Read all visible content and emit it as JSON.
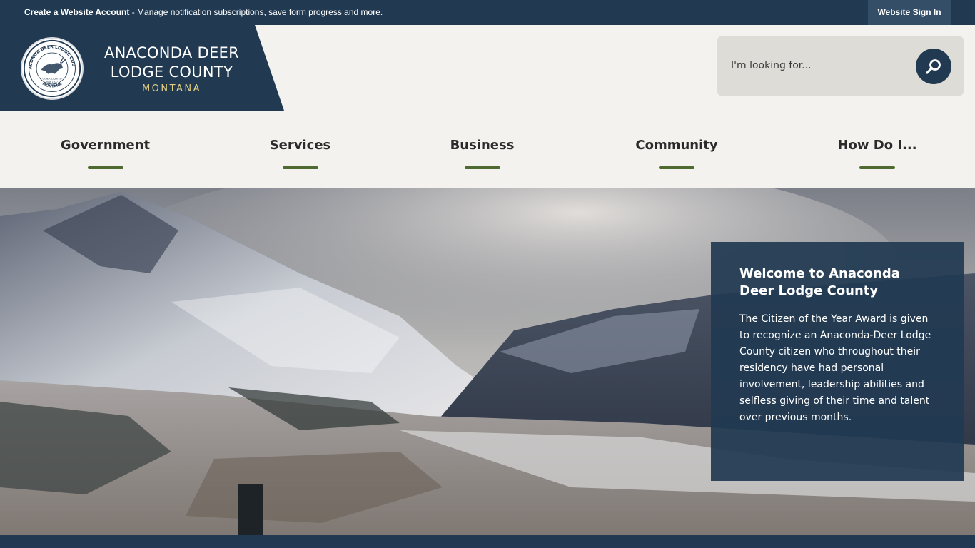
{
  "topbar": {
    "account_link": "Create a Website Account",
    "account_desc": " - Manage notification subscriptions, save form progress and more.",
    "signin_label": "Website Sign In"
  },
  "header": {
    "county_line1": "ANACONDA DEER",
    "county_line2": "LODGE COUNTY",
    "state": "MONTANA",
    "seal": {
      "text_top": "ANACONDA DEER LODGE COUNTY",
      "text_bottom": "MONTANA",
      "text_mid": "CONSOLIDATED",
      "text_date": "MAY 1977"
    }
  },
  "search": {
    "placeholder": "I'm looking for..."
  },
  "nav": {
    "items": [
      {
        "label": "Government"
      },
      {
        "label": "Services"
      },
      {
        "label": "Business"
      },
      {
        "label": "Community"
      },
      {
        "label": "How Do I..."
      }
    ]
  },
  "hero": {
    "welcome_title": "Welcome to Anaconda Deer Lodge County",
    "welcome_body": "The Citizen of the Year Award is given to recognize an Anaconda-Deer Lodge County citizen who throughout their residency have had personal involvement, leadership abilities and selfless giving of their time and talent over previous months."
  },
  "colors": {
    "navy": "#213a52",
    "accent_green": "#4e6a30",
    "gold": "#e2cf84",
    "header_bg": "#f3f2ef"
  }
}
